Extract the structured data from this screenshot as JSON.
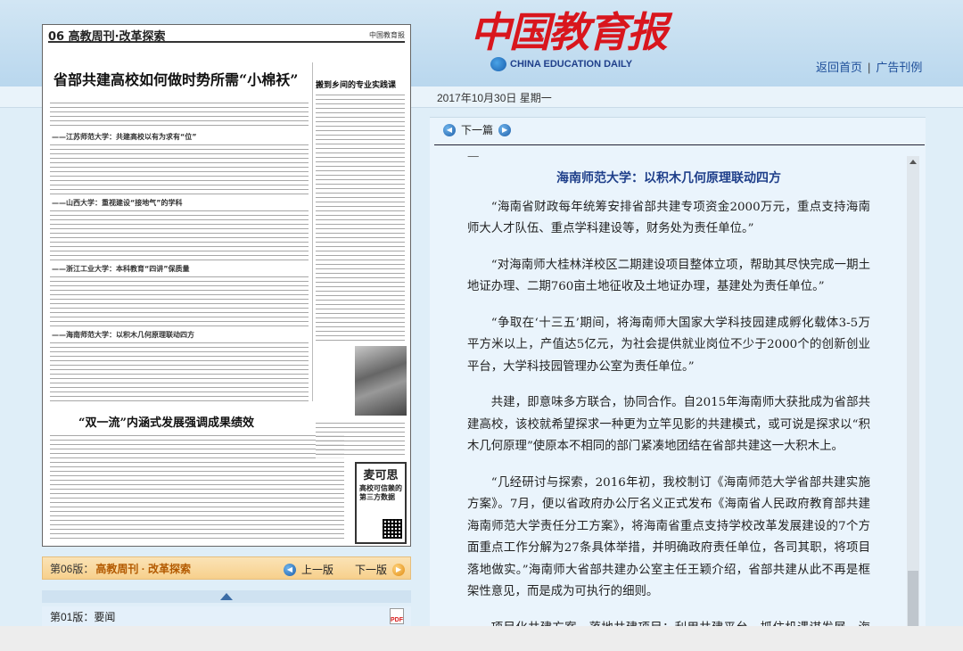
{
  "header": {
    "logo_cn": "中国教育报",
    "logo_en": "CHINA EDUCATION DAILY",
    "links": {
      "home": "返回首页",
      "sep": "|",
      "ads": "广告刊例"
    },
    "date": "2017年10月30日  星期一"
  },
  "paper_page": {
    "page_header_left": "06 高教周刊·改革探索",
    "page_header_right": "中国教育报",
    "headline": "省部共建高校如何做时势所需“小棉袄”",
    "side_headline": "搬到乡间的专业实践课",
    "section_1": "——江苏师范大学：共建高校以有为求有“位”",
    "section_2": "——山西大学：重视建设“接地气”的学科",
    "section_3": "——浙江工业大学：本科教育“四讲”保质量",
    "section_4": "——海南师范大学：以积木几何原理联动四方",
    "bottom_headline": "“双一流”内涵式发展强调成果绩效",
    "ad_title": "麦可思",
    "ad_body": "高校可信赖的第三方数据"
  },
  "page_bar": {
    "label": "第06版：",
    "name": "高教周刊 · 改革探索",
    "prev": "上一版",
    "next": "下一版"
  },
  "page_list": [
    {
      "label": "第01版：要闻",
      "pdf": "PDF"
    }
  ],
  "article_nav": {
    "next": "下一篇"
  },
  "article": {
    "heading": "海南师范大学：以积木几何原理联动四方",
    "paragraphs": [
      "“海南省财政每年统筹安排省部共建专项资金2000万元，重点支持海南师大人才队伍、重点学科建设等，财务处为责任单位。”",
      "“对海南师大桂林洋校区二期建设项目整体立项，帮助其尽快完成一期土地证办理、二期760亩土地征收及土地证办理，基建处为责任单位。”",
      "“争取在‘十三五’期间，将海南师大国家大学科技园建成孵化载体3-5万平方米以上，产值达5亿元，为社会提供就业岗位不少于2000个的创新创业平台，大学科技园管理办公室为责任单位。”",
      "共建，即意味多方联合，协同合作。自2015年海南师大获批成为省部共建高校，该校就希望探求一种更为立竿见影的共建模式，或可说是探求以“积木几何原理”使原本不相同的部门紧凑地团结在省部共建这一大积木上。",
      "“几经研讨与探索，2016年初，我校制订《海南师范大学省部共建实施方案》。7月，便以省政府办公厅名义正式发布《海南省人民政府教育部共建海南师范大学责任分工方案》，将海南省重点支持学校改革发展建设的7个方面重点工作分解为27条具体举措，并明确政府责任单位，各司其职，将项目落地做实。”海南师大省部共建办公室主任王颖介绍，省部共建从此不再是框架性意见，而是成为可执行的细则。",
      "项目化共建方案，落地共建项目；利用共建平台，抓住机遇谋发展。海南师大短时间内即获得政策、财政等大力支持，还在两年内择优完成定向招收海南籍免费师范生400名招生计划，获批马克思主义理论和化学两个"
    ]
  }
}
